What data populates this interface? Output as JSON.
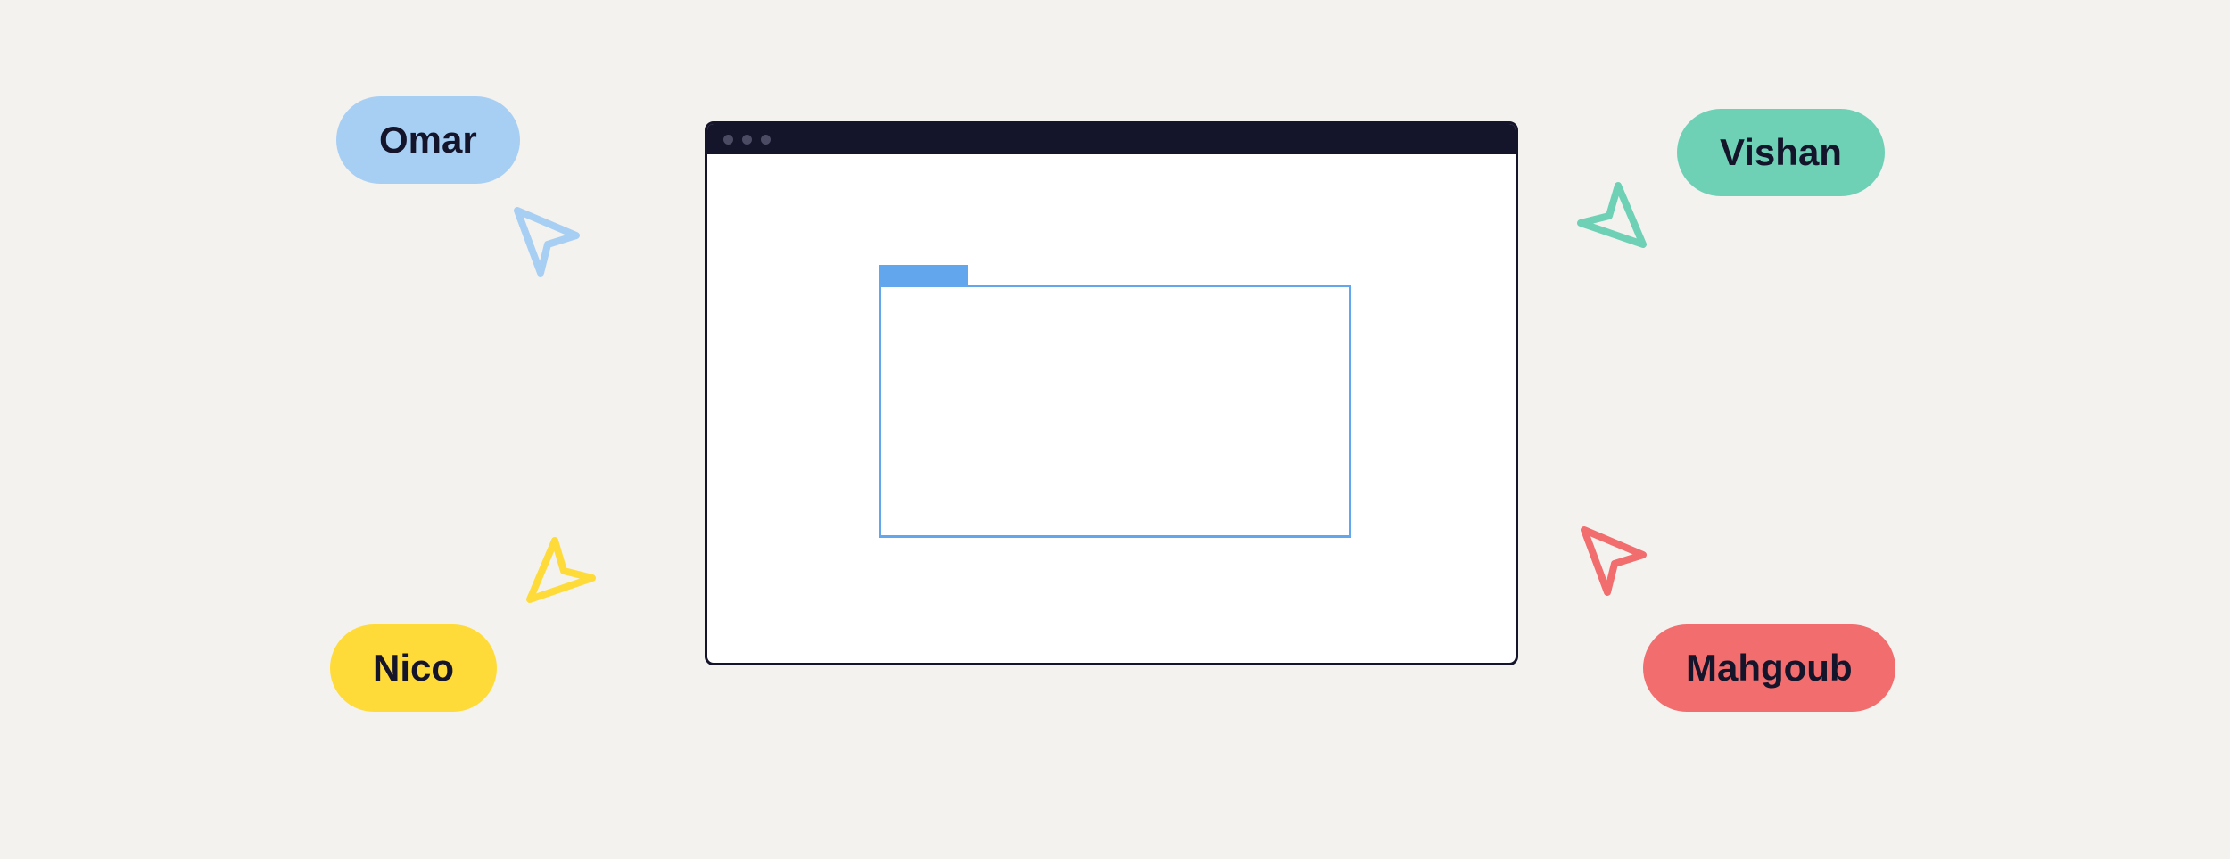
{
  "users": [
    {
      "name": "Omar",
      "pill_color": "#a7cff4",
      "cursor_color": "#a7cff4"
    },
    {
      "name": "Nico",
      "pill_color": "#ffdb3a",
      "cursor_color": "#ffdb3a"
    },
    {
      "name": "Vishan",
      "pill_color": "#6ed1b6",
      "cursor_color": "#6ed1b6"
    },
    {
      "name": "Mahgoub",
      "pill_color": "#f26d6d",
      "cursor_color": "#f26d6d"
    }
  ],
  "colors": {
    "background": "#f3f2ef",
    "window_border": "#14142b",
    "window_bar": "#14142b",
    "folder_stroke": "#62a6ee",
    "text": "#14142b"
  }
}
